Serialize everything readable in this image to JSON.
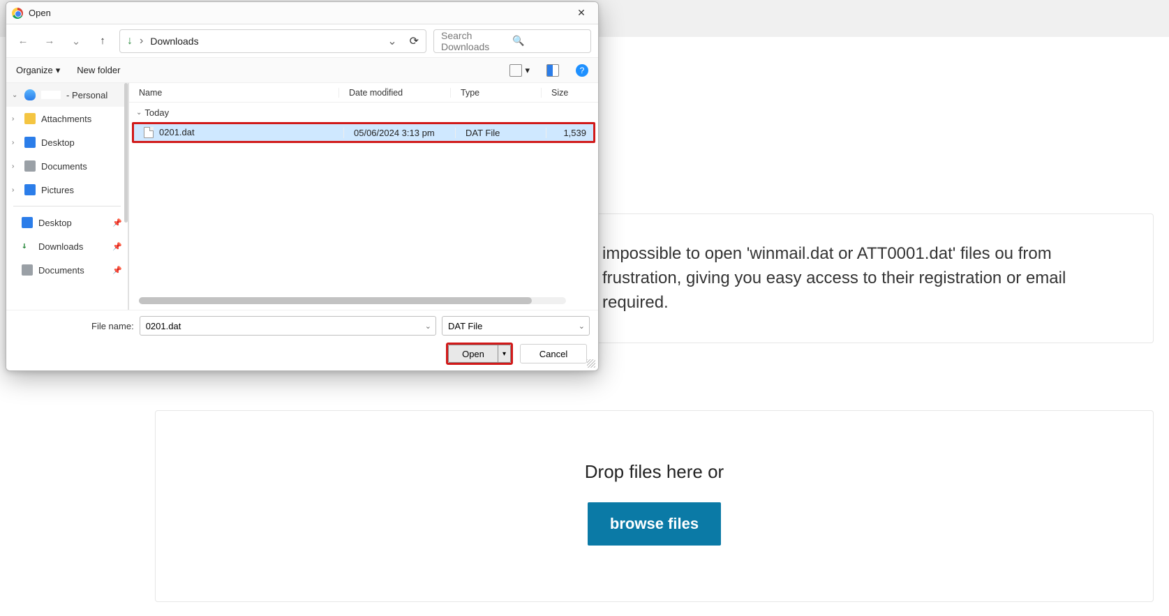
{
  "page": {
    "paragraph": "impossible to open 'winmail.dat or ATT0001.dat' files ou from frustration, giving you easy access to their registration or email required.",
    "drop_text": "Drop files here or",
    "browse_label": "browse files"
  },
  "dialog": {
    "title": "Open",
    "nav": {
      "path_label": "Downloads"
    },
    "search": {
      "placeholder": "Search Downloads"
    },
    "toolbar": {
      "organize": "Organize",
      "new_folder": "New folder"
    },
    "tree": {
      "personal": "- Personal",
      "items_top": [
        {
          "label": "Attachments",
          "icon": "folder"
        },
        {
          "label": "Desktop",
          "icon": "desktop"
        },
        {
          "label": "Documents",
          "icon": "docs"
        },
        {
          "label": "Pictures",
          "icon": "pics"
        }
      ],
      "items_quick": [
        {
          "label": "Desktop",
          "icon": "desktop",
          "pinned": true
        },
        {
          "label": "Downloads",
          "icon": "dl",
          "pinned": true
        },
        {
          "label": "Documents",
          "icon": "docs",
          "pinned": true
        }
      ]
    },
    "columns": {
      "name": "Name",
      "date": "Date modified",
      "type": "Type",
      "size": "Size"
    },
    "group_label": "Today",
    "file": {
      "name": "0201.dat",
      "date": "05/06/2024 3:13 pm",
      "type": "DAT File",
      "size": "1,539"
    },
    "footer": {
      "filename_label": "File name:",
      "filename_value": "0201.dat",
      "filter_value": "DAT File",
      "open_label": "Open",
      "cancel_label": "Cancel"
    }
  }
}
